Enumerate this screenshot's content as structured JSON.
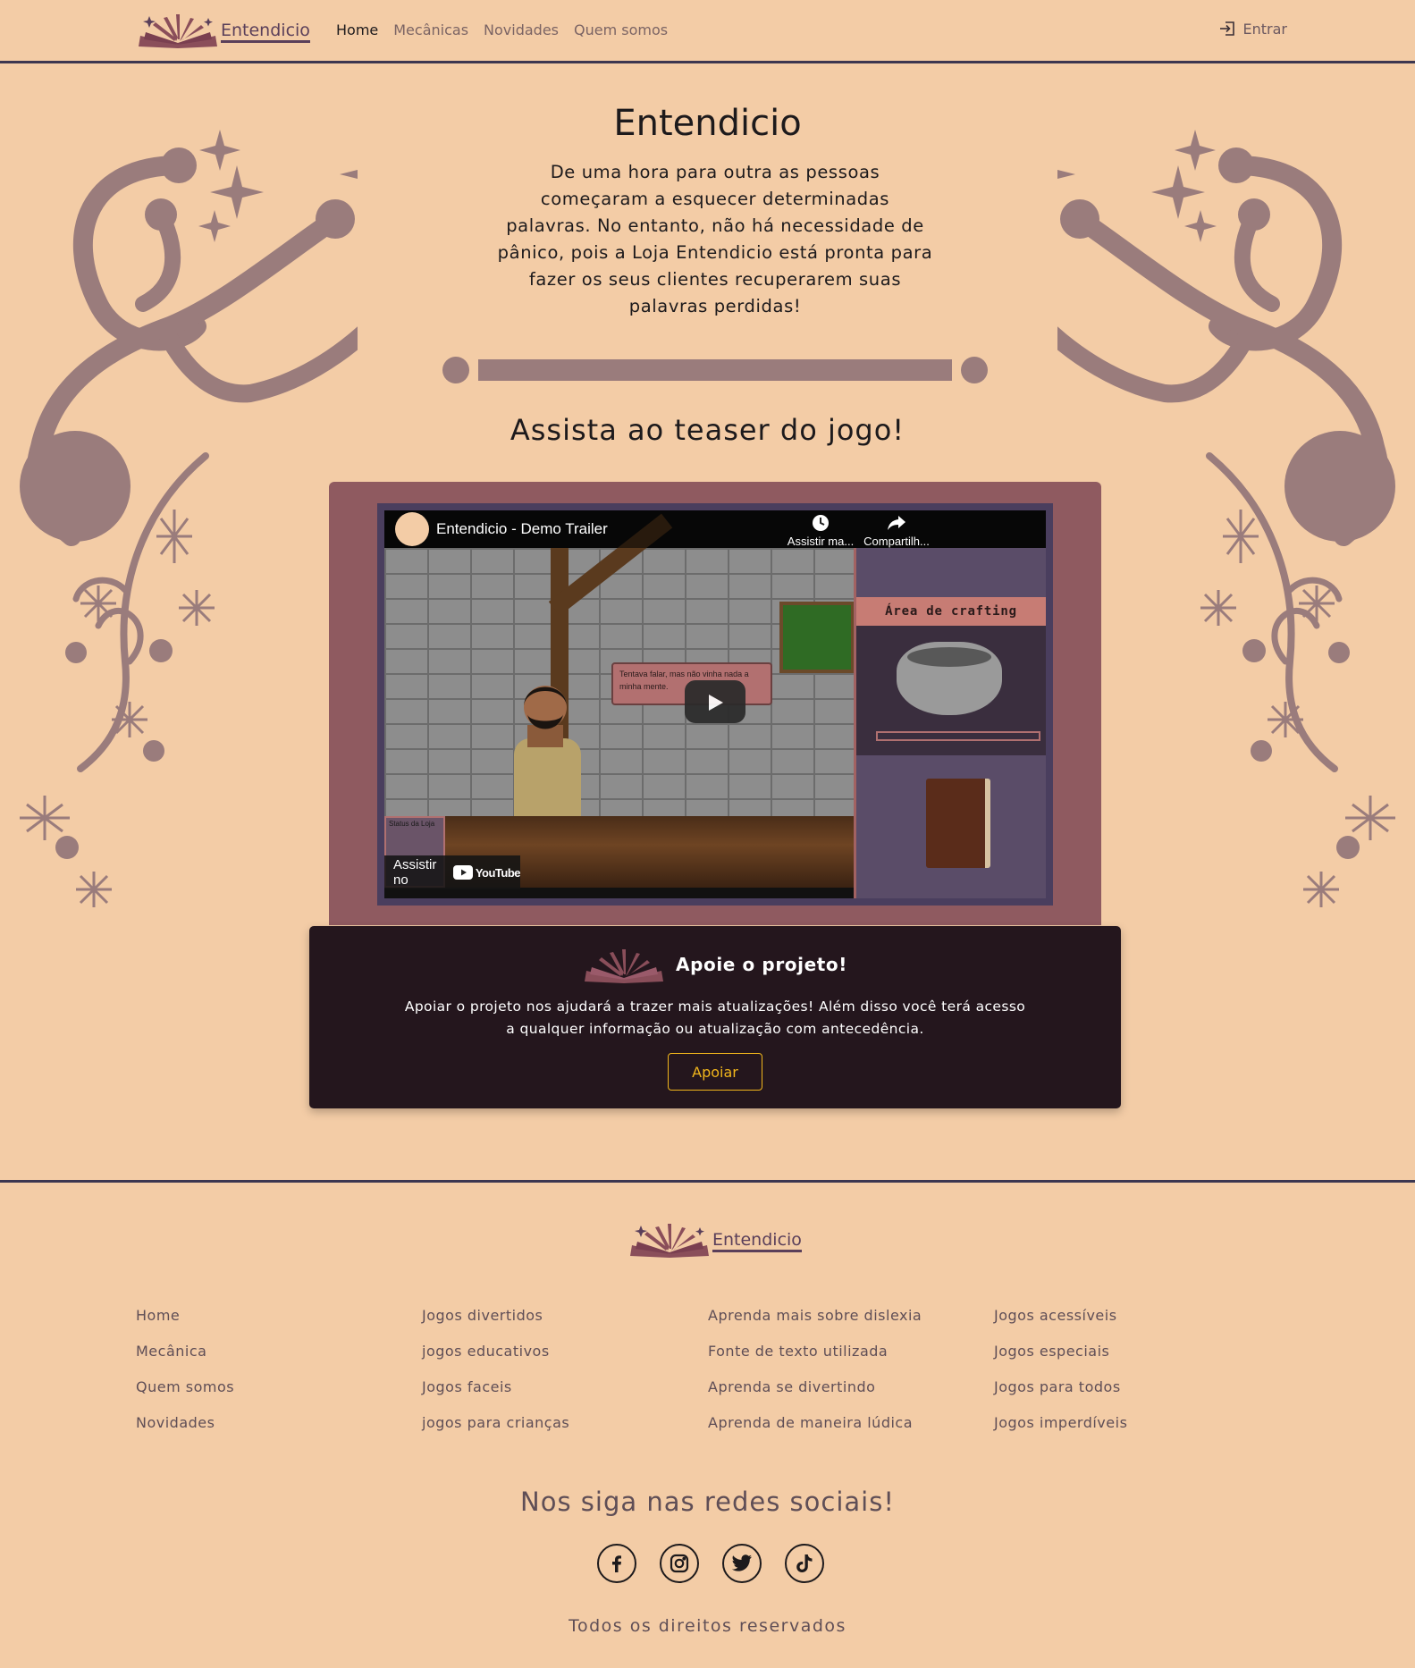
{
  "nav": {
    "brand": "Entendicio",
    "links": [
      "Home",
      "Mecânicas",
      "Novidades",
      "Quem somos"
    ],
    "login": "Entrar"
  },
  "hero": {
    "title": "Entendicio",
    "text": "De uma hora para outra as pessoas começaram a esquecer determinadas palavras. No entanto, não há necessidade de pânico, pois a Loja Entendicio está pronta para fazer os seus clientes recuperarem suas palavras perdidas!"
  },
  "teaser": {
    "title": "Assista ao teaser do jogo!",
    "video_title": "Entendicio - Demo Trailer",
    "watch_later": "Assistir ma...",
    "share": "Compartilh...",
    "watch_on": "Assistir no",
    "youtube": "YouTube",
    "game_speech": "Tentava falar, mas não vinha nada a minha mente.",
    "game_panel_title": "Área de crafting",
    "game_status": "Status da Loja"
  },
  "support": {
    "title": "Apoie o projeto!",
    "text": "Apoiar o projeto nos ajudará a trazer mais atualizações! Além disso você terá acesso a qualquer informação ou atualização com antecedência.",
    "button": "Apoiar"
  },
  "footer": {
    "brand": "Entendicio",
    "columns": [
      [
        "Home",
        "Mecânica",
        "Quem somos",
        "Novidades"
      ],
      [
        "Jogos divertidos",
        "jogos educativos",
        "Jogos faceis",
        "jogos para crianças"
      ],
      [
        "Aprenda mais sobre dislexia",
        "Fonte de texto utilizada",
        "Aprenda se divertindo",
        "Aprenda de maneira lúdica"
      ],
      [
        "Jogos acessíveis",
        "Jogos especiais",
        "Jogos para todos",
        "Jogos imperdíveis"
      ]
    ],
    "social_title": "Nos siga nas redes sociais!",
    "social_icons": [
      "facebook-icon",
      "instagram-icon",
      "twitter-icon",
      "tiktok-icon"
    ],
    "copyright": "Todos os direitos reservados"
  },
  "colors": {
    "background": "#f3cca6",
    "decoration": "#9a7c7c",
    "video_frame": "#8f5a60",
    "support_bg": "#24161d",
    "accent": "#f0b51c",
    "border": "#3c3650"
  }
}
